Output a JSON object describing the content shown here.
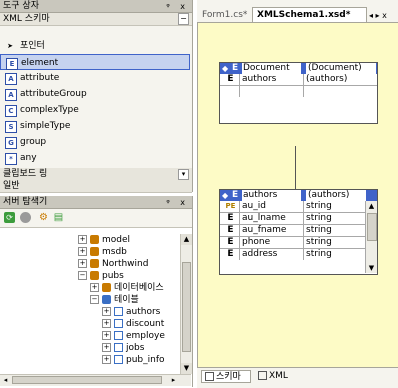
{
  "toolbox": {
    "title": "도구 상자",
    "controls": "ᵠ x",
    "section": "XML 스키마",
    "section_toggle": "−",
    "items": [
      {
        "label": "포인터",
        "icon": "pointer-icon",
        "glyph": "➤"
      },
      {
        "label": "element",
        "icon": "element-icon",
        "glyph": "E"
      },
      {
        "label": "attribute",
        "icon": "attribute-icon",
        "glyph": "A"
      },
      {
        "label": "attributeGroup",
        "icon": "attribute-group-icon",
        "glyph": "A"
      },
      {
        "label": "complexType",
        "icon": "complex-type-icon",
        "glyph": "C"
      },
      {
        "label": "simpleType",
        "icon": "simple-type-icon",
        "glyph": "S"
      },
      {
        "label": "group",
        "icon": "group-icon",
        "glyph": "G"
      },
      {
        "label": "any",
        "icon": "any-icon",
        "glyph": "*"
      }
    ],
    "clipboard_ring": "클립보드 링",
    "general": "일반"
  },
  "server_explorer": {
    "title": "서버 탐색기",
    "controls": "ᵠ x",
    "tree": [
      {
        "label": "model",
        "level": 0,
        "expander": "+"
      },
      {
        "label": "msdb",
        "level": 0,
        "expander": "+"
      },
      {
        "label": "Northwind",
        "level": 0,
        "expander": "+"
      },
      {
        "label": "pubs",
        "level": 0,
        "expander": "−"
      },
      {
        "label": "데이터베이스",
        "level": 1,
        "expander": "+"
      },
      {
        "label": "테이블",
        "level": 1,
        "expander": "−"
      },
      {
        "label": "authors",
        "level": 2,
        "expander": "+"
      },
      {
        "label": "discount",
        "level": 2,
        "expander": "+"
      },
      {
        "label": "employe",
        "level": 2,
        "expander": "+"
      },
      {
        "label": "jobs",
        "level": 2,
        "expander": "+"
      },
      {
        "label": "pub_info",
        "level": 2,
        "expander": "+"
      }
    ]
  },
  "editor": {
    "tabs": [
      {
        "label": "Form1.cs*",
        "active": false
      },
      {
        "label": "XMLSchema1.xsd*",
        "active": true
      }
    ],
    "tab_nav": "◂ ▸ x",
    "document_table": {
      "header": {
        "kind": "E",
        "name": "Document",
        "type": "(Document)"
      },
      "rows": [
        {
          "kind": "E",
          "name": "authors",
          "type": "(authors)"
        }
      ]
    },
    "authors_table": {
      "header": {
        "kind": "E",
        "name": "authors",
        "type": "(authors)"
      },
      "rows": [
        {
          "kind": "PE",
          "name": "au_id",
          "type": "string"
        },
        {
          "kind": "E",
          "name": "au_lname",
          "type": "string"
        },
        {
          "kind": "E",
          "name": "au_fname",
          "type": "string"
        },
        {
          "kind": "E",
          "name": "phone",
          "type": "string"
        },
        {
          "kind": "E",
          "name": "address",
          "type": "string"
        }
      ]
    },
    "bottom_tabs": [
      {
        "label": "스키마",
        "active": true
      },
      {
        "label": "XML",
        "active": false
      }
    ]
  },
  "colors": {
    "designer_bg": "#fdfbc6",
    "panel_bg": "#f5f4ee",
    "header_blue": "#3f63c9",
    "selected_item": "#c6d3ef"
  }
}
